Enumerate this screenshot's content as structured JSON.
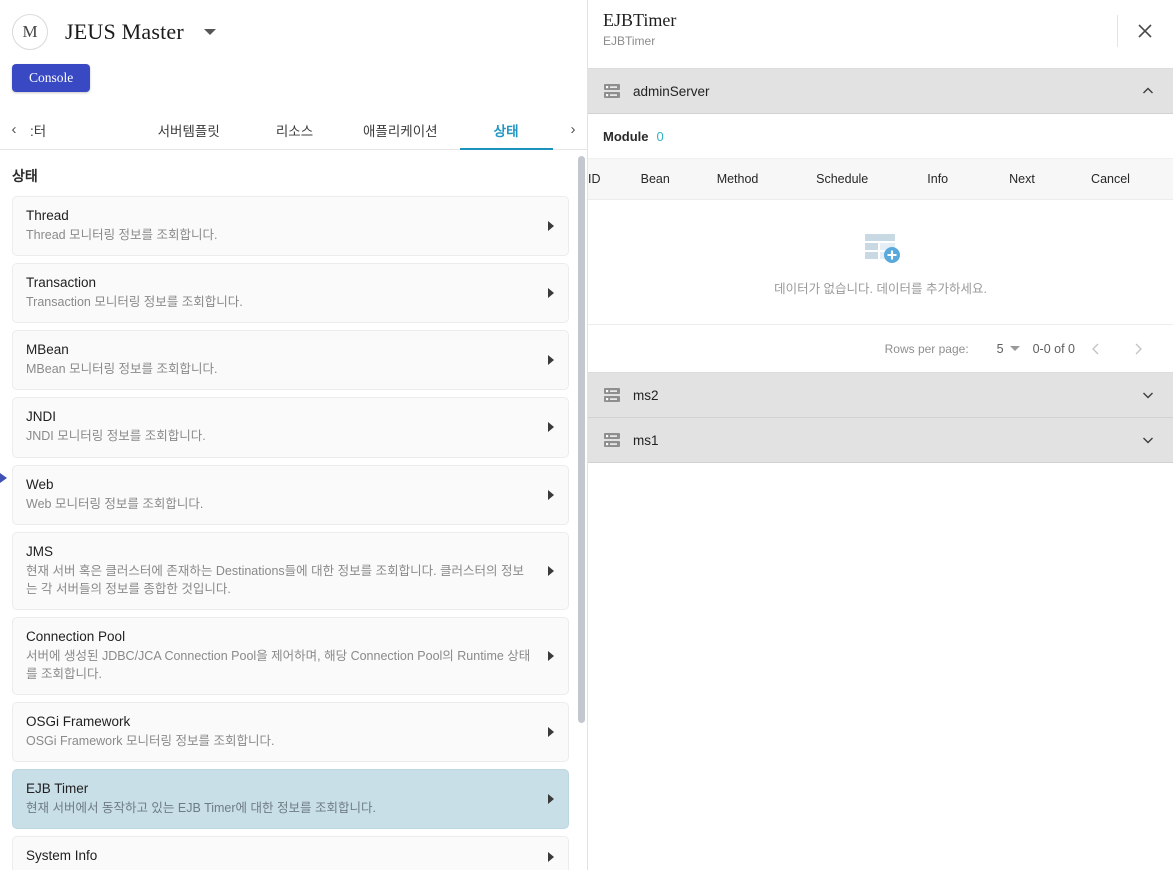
{
  "left": {
    "brand": {
      "avatar_initial": "M",
      "title": "JEUS Master",
      "caret_icon": "chevron-down-icon"
    },
    "console_button": "Console",
    "tabbar": {
      "prev_icon": "‹",
      "next_icon": "›",
      "tabs": [
        {
          "label": ":터",
          "active": false
        },
        {
          "label": "서버템플릿",
          "active": false
        },
        {
          "label": "리소스",
          "active": false
        },
        {
          "label": "애플리케이션",
          "active": false
        },
        {
          "label": "상태",
          "active": true
        }
      ]
    },
    "section_title": "상태",
    "items": [
      {
        "title": "Thread",
        "desc": "Thread 모니터링 정보를 조회합니다.",
        "selected": false
      },
      {
        "title": "Transaction",
        "desc": "Transaction 모니터링 정보를 조회합니다.",
        "selected": false
      },
      {
        "title": "MBean",
        "desc": "MBean 모니터링 정보를 조회합니다.",
        "selected": false
      },
      {
        "title": "JNDI",
        "desc": "JNDI 모니터링 정보를 조회합니다.",
        "selected": false
      },
      {
        "title": "Web",
        "desc": "Web 모니터링 정보를 조회합니다.",
        "selected": false
      },
      {
        "title": "JMS",
        "desc": "현재 서버 혹은 클러스터에 존재하는 Destinations들에 대한 정보를 조회합니다. 클러스터의 정보는 각 서버들의 정보를 종합한 것입니다.",
        "selected": false
      },
      {
        "title": "Connection Pool",
        "desc": "서버에 생성된 JDBC/JCA Connection Pool을 제어하며, 해당 Connection Pool의 Runtime 상태를 조회합니다.",
        "selected": false
      },
      {
        "title": "OSGi Framework",
        "desc": "OSGi Framework 모니터링 정보를 조회합니다.",
        "selected": false
      },
      {
        "title": "EJB Timer",
        "desc": "현재 서버에서 동작하고 있는 EJB Timer에 대한 정보를 조회합니다.",
        "selected": true
      },
      {
        "title": "System Info",
        "desc": "",
        "selected": false
      }
    ]
  },
  "right": {
    "header": {
      "title": "EJBTimer",
      "subtitle": "EJBTimer",
      "close_icon": "close-icon"
    },
    "servers": [
      {
        "name": "adminServer",
        "icon": "server-icon",
        "expanded": true,
        "chevron": "chevron-up-icon"
      },
      {
        "name": "ms2",
        "icon": "server-icon",
        "expanded": false,
        "chevron": "chevron-down-icon"
      },
      {
        "name": "ms1",
        "icon": "server-icon",
        "expanded": false,
        "chevron": "chevron-down-icon"
      }
    ],
    "module": {
      "label": "Module",
      "count": "0",
      "count_color": "#2fb5c8"
    },
    "table": {
      "columns": [
        "ID",
        "Bean",
        "Method",
        "Schedule",
        "Info",
        "Next",
        "Cancel"
      ],
      "rows": [],
      "empty_icon": "table-add-icon",
      "empty_text": "데이터가 없습니다. 데이터를 추가하세요."
    },
    "pagination": {
      "rows_per_page_label": "Rows per page:",
      "rows_per_page_value": "5",
      "range": "0-0 of 0",
      "prev_icon": "chevron-left-icon",
      "next_icon": "chevron-right-icon"
    }
  },
  "theme": {
    "accent_blue": "#3949c4",
    "accent_teal": "#1b93bd",
    "selected_row": "#c9dfe8",
    "server_row_bg": "#e2e2e2"
  }
}
